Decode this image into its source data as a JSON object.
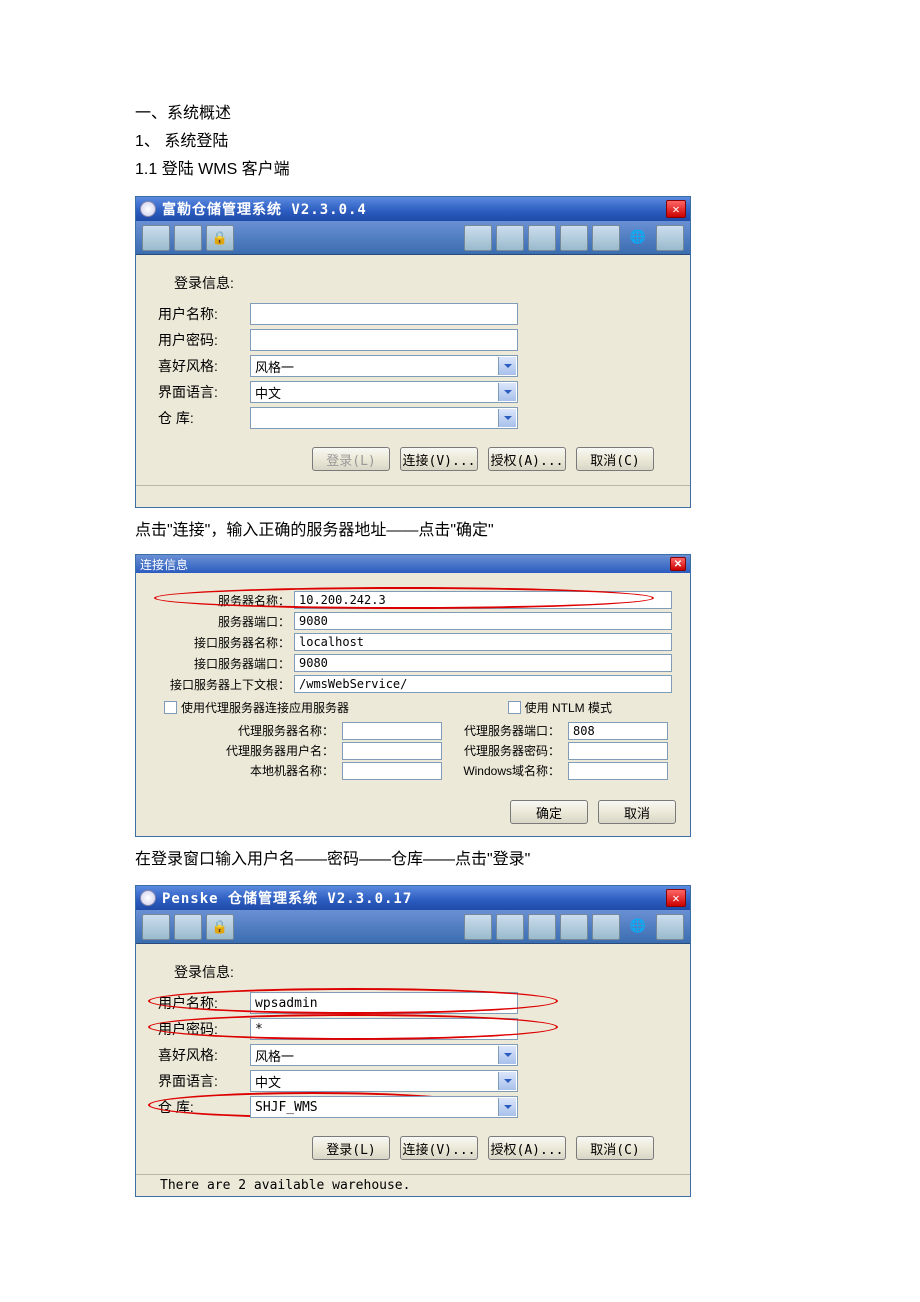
{
  "doc": {
    "h1": "一、系统概述",
    "h2": "1、 系统登陆",
    "h3": "1.1  登陆 WMS 客户端",
    "p1": "点击\"连接\"，输入正确的服务器地址——点击\"确定\"",
    "p2": "在登录窗口输入用户名——密码——仓库——点击\"登录\""
  },
  "login1": {
    "title": "富勒仓储管理系统  V2.3.0.4",
    "section": "登录信息:",
    "fields": {
      "user_label": "用户名称:",
      "user_value": "",
      "pwd_label": "用户密码:",
      "pwd_value": "",
      "style_label": "喜好风格:",
      "style_value": "风格一",
      "lang_label": "界面语言:",
      "lang_value": "中文",
      "wh_label": "仓        库:",
      "wh_value": ""
    },
    "buttons": {
      "login": "登录(L)",
      "connect": "连接(V)...",
      "auth": "授权(A)...",
      "cancel": "取消(C)"
    }
  },
  "conn": {
    "title": "连接信息",
    "server_name_label": "服务器名称：",
    "server_name_value": "10.200.242.3",
    "server_port_label": "服务器端口：",
    "server_port_value": "9080",
    "iface_name_label": "接口服务器名称：",
    "iface_name_value": "localhost",
    "iface_port_label": "接口服务器端口：",
    "iface_port_value": "9080",
    "ctx_label": "接口服务器上下文根：",
    "ctx_value": "/wmsWebService/",
    "use_proxy_label": "使用代理服务器连接应用服务器",
    "use_ntlm_label": "使用 NTLM 模式",
    "proxy_server_label": "代理服务器名称：",
    "proxy_port_label": "代理服务器端口：",
    "proxy_port_value": "808",
    "proxy_user_label": "代理服务器用户名：",
    "proxy_pwd_label": "代理服务器密码：",
    "local_label": "本地机器名称：",
    "domain_label": "Windows域名称：",
    "ok": "确定",
    "cancel": "取消"
  },
  "login2": {
    "title": "Penske  仓储管理系统  V2.3.0.17",
    "section": "登录信息:",
    "fields": {
      "user_label": "用户名称:",
      "user_value": "wpsadmin",
      "pwd_label": "用户密码:",
      "pwd_value": "*",
      "style_label": "喜好风格:",
      "style_value": "风格一",
      "lang_label": "界面语言:",
      "lang_value": "中文",
      "wh_label": "仓        库:",
      "wh_value": "SHJF_WMS"
    },
    "buttons": {
      "login": "登录(L)",
      "connect": "连接(V)...",
      "auth": "授权(A)...",
      "cancel": "取消(C)"
    },
    "status": "There are 2 available warehouse."
  }
}
